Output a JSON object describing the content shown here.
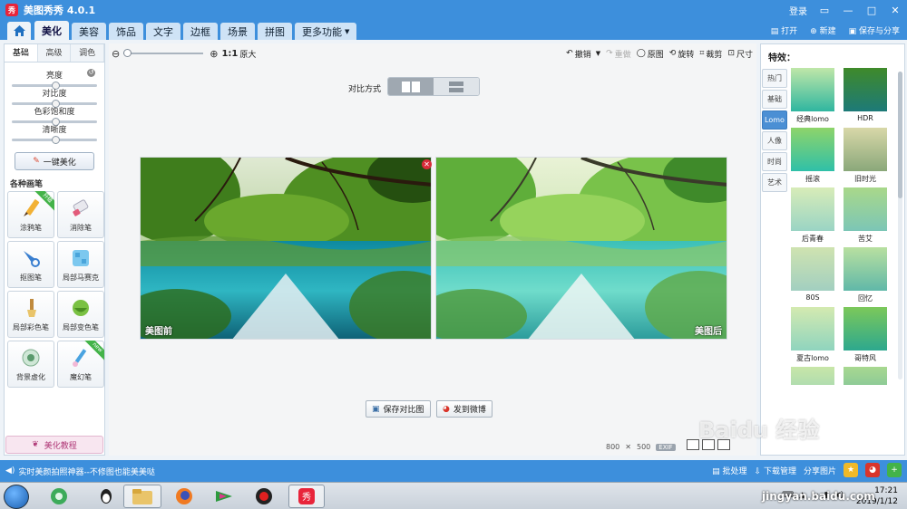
{
  "app": {
    "title": "美图秀秀 4.0.1",
    "logo_text": "秀",
    "login": "登录"
  },
  "menu": {
    "tabs": [
      "美化",
      "美容",
      "饰品",
      "文字",
      "边框",
      "场景",
      "拼图",
      "更多功能"
    ],
    "active": 0,
    "open": "打开",
    "new": "新建",
    "save_share": "保存与分享"
  },
  "left": {
    "subtabs": [
      "基础",
      "高级",
      "调色"
    ],
    "sliders": [
      {
        "label": "亮度",
        "value": 0.5
      },
      {
        "label": "对比度",
        "value": 0.5
      },
      {
        "label": "色彩饱和度",
        "value": 0.5
      },
      {
        "label": "清晰度",
        "value": 0.5
      }
    ],
    "one_key": "一键美化",
    "brush_title": "各种画笔",
    "brushes": [
      {
        "label": "涂鸦笔",
        "badge": "升级"
      },
      {
        "label": "消除笔",
        "badge": ""
      },
      {
        "label": "抠图笔",
        "badge": ""
      },
      {
        "label": "局部马赛克",
        "badge": ""
      },
      {
        "label": "局部彩色笔",
        "badge": ""
      },
      {
        "label": "局部变色笔",
        "badge": ""
      },
      {
        "label": "背景虚化",
        "badge": ""
      },
      {
        "label": "魔幻笔",
        "badge": "new"
      }
    ],
    "tutorial": "美化教程"
  },
  "canvas": {
    "zoom_11": "1:1",
    "zoom_orig": "原大",
    "tools": {
      "undo": "撤销",
      "redo": "重做",
      "original": "原图",
      "rotate": "旋转",
      "crop": "裁剪",
      "size": "尺寸"
    },
    "compare_label": "对比方式",
    "before_label": "美图前",
    "after_label": "美图后",
    "save_compare": "保存对比图",
    "post_weibo": "发到微博",
    "dims_w": "800",
    "dims_x": "✕",
    "dims_h": "500",
    "exif": "EXIF"
  },
  "right": {
    "title": "特效：",
    "tabs": [
      "热门",
      "基础",
      "Lomo",
      "人像",
      "时尚",
      "艺术"
    ],
    "active_tab": 2,
    "effects": [
      "经典lomo",
      "HDR",
      "摇滚",
      "旧时光",
      "后青春",
      "苦艾",
      "80S",
      "回忆",
      "夏古lomo",
      "哥特风",
      "",
      ""
    ]
  },
  "status": {
    "message": "实时美颜拍照神器--不修图也能美美哒",
    "batch": "批处理",
    "download": "下载管理",
    "share": "分享图片"
  },
  "taskbar": {
    "time": "17:21",
    "date": "2019/1/12"
  },
  "watermark": {
    "logo": "Baidu 经验",
    "url": "jingyan.baidu.com"
  },
  "colors": {
    "brand_blue": "#3d8fdc",
    "accent_red": "#e8243a",
    "new_green": "#43b349"
  }
}
